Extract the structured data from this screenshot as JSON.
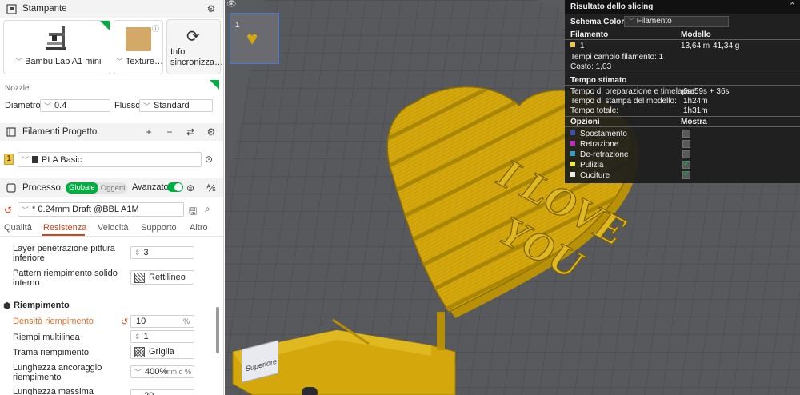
{
  "printer": {
    "section_title": "Stampante",
    "printer_name": "Bambu Lab A1 mini",
    "plate_label": "Texture…",
    "sync_label_1": "Info",
    "sync_label_2": "sincronizza…"
  },
  "nozzle": {
    "section_title": "Nozzle",
    "diameter_label": "Diametro",
    "diameter_value": "0.4",
    "flow_label": "Flusso",
    "flow_value": "Standard"
  },
  "filaments": {
    "section_title": "Filamenti Progetto",
    "items": [
      {
        "index": "1",
        "name": "PLA Basic",
        "color": "#f2c744"
      }
    ]
  },
  "process": {
    "section_title": "Processo",
    "toggle_global": "Globale",
    "toggle_objects": "Oggetti",
    "advanced_label": "Avanzato",
    "profile": "* 0.24mm Draft @BBL A1M",
    "tabs": [
      "Qualità",
      "Resistenza",
      "Velocità",
      "Supporto",
      "Altro"
    ],
    "active_tab": "Resistenza",
    "settings": {
      "bottom_layers_label_1": "Layer penetrazione pittura",
      "bottom_layers_label_2": "inferiore",
      "bottom_layers_value": "3",
      "bottom_pattern_label_1": "Pattern riempimento solido",
      "bottom_pattern_label_2": "interno",
      "bottom_pattern_value": "Rettilineo",
      "infill_group": "Riempimento",
      "density_label": "Densità riempimento",
      "density_value": "10",
      "density_unit": "%",
      "multiline_label": "Riempi multilinea",
      "multiline_value": "1",
      "pattern_label": "Trama riempimento",
      "pattern_value": "Griglia",
      "anchor_label_1": "Lunghezza ancoraggio",
      "anchor_label_2": "riempimento",
      "anchor_value": "400%",
      "anchor_unit": "mm o %",
      "max_label": "Lunghezza massima",
      "max_value": "20"
    }
  },
  "viewport": {
    "plate_number": "1",
    "view_cube_label": "Superiore",
    "model_text_1": "I LOVE",
    "model_text_2": "YOU",
    "model_color": "#d4a80c"
  },
  "result": {
    "title": "Risultato dello slicing",
    "color_scheme_label": "Schema Colore",
    "color_scheme_value": "Filamento",
    "col_filament": "Filamento",
    "col_model": "Modello",
    "filament_index": "1",
    "filament_length": "13,64 m",
    "filament_weight": "41,34 g",
    "changes": "Tempi cambio filamento:  1",
    "cost": "Costo:  1,03",
    "time_header": "Tempo stimato",
    "prep_label": "Tempo di preparazione e timelapse:",
    "prep_value": "6m59s + 36s",
    "print_label": "Tempo di stampa del modello:",
    "print_value": "1h24m",
    "total_label": "Tempo totale:",
    "total_value": "1h31m",
    "options_header": "Opzioni",
    "show_header": "Mostra",
    "options": [
      {
        "label": "Spostamento",
        "color": "#3a4fb8",
        "checked": false
      },
      {
        "label": "Retrazione",
        "color": "#c02ad0",
        "checked": false
      },
      {
        "label": "De-retrazione",
        "color": "#2aa0d0",
        "checked": false
      },
      {
        "label": "Pulizia",
        "color": "#f2e64a",
        "checked": true
      },
      {
        "label": "Cuciture",
        "color": "#ececec",
        "checked": true
      }
    ]
  }
}
